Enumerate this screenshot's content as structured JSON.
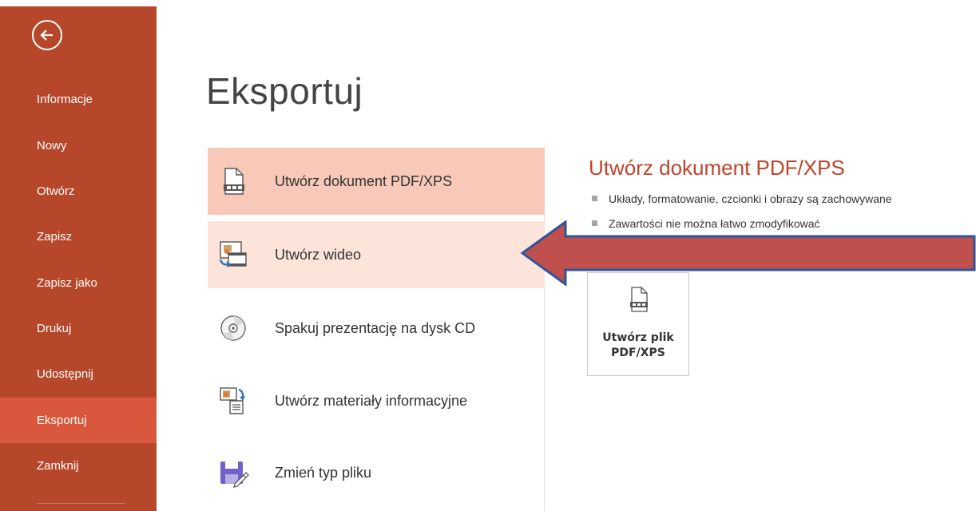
{
  "sidebar": {
    "back_icon": "back-arrow-icon",
    "items": [
      {
        "label": "Informacje",
        "active": false
      },
      {
        "label": "Nowy",
        "active": false
      },
      {
        "label": "Otwórz",
        "active": false
      },
      {
        "label": "Zapisz",
        "active": false
      },
      {
        "label": "Zapisz jako",
        "active": false
      },
      {
        "label": "Drukuj",
        "active": false
      },
      {
        "label": "Udostępnij",
        "active": false
      },
      {
        "label": "Eksportuj",
        "active": true
      },
      {
        "label": "Zamknij",
        "active": false
      }
    ]
  },
  "main": {
    "title": "Eksportuj",
    "options": [
      {
        "label": "Utwórz dokument PDF/XPS",
        "icon": "pdf-document-icon",
        "state": "selected"
      },
      {
        "label": "Utwórz wideo",
        "icon": "video-icon",
        "state": "hover"
      },
      {
        "label": "Spakuj prezentację na dysk CD",
        "icon": "cd-icon",
        "state": "normal"
      },
      {
        "label": "Utwórz materiały informacyjne",
        "icon": "handouts-icon",
        "state": "normal"
      },
      {
        "label": "Zmień typ pliku",
        "icon": "save-file-icon",
        "state": "normal"
      }
    ]
  },
  "detail": {
    "title": "Utwórz dokument PDF/XPS",
    "bullets": [
      "Układy, formatowanie, czcionki i obrazy są zachowywane",
      "Zawartości nie można łatwo zmodyfikować"
    ],
    "button": {
      "line1": "Utwórz plik",
      "line2": "PDF/XPS",
      "icon": "pdf-document-icon"
    }
  },
  "annotation": {
    "icon": "red-arrow-pointer",
    "color": "#c0504d",
    "border": "#2f5597"
  },
  "colors": {
    "sidebar": "#b7472a",
    "sidebar_active": "#d9573c",
    "accent": "#c0442a",
    "selected_bg": "#f8c9b9",
    "hover_bg": "#fce4da"
  }
}
